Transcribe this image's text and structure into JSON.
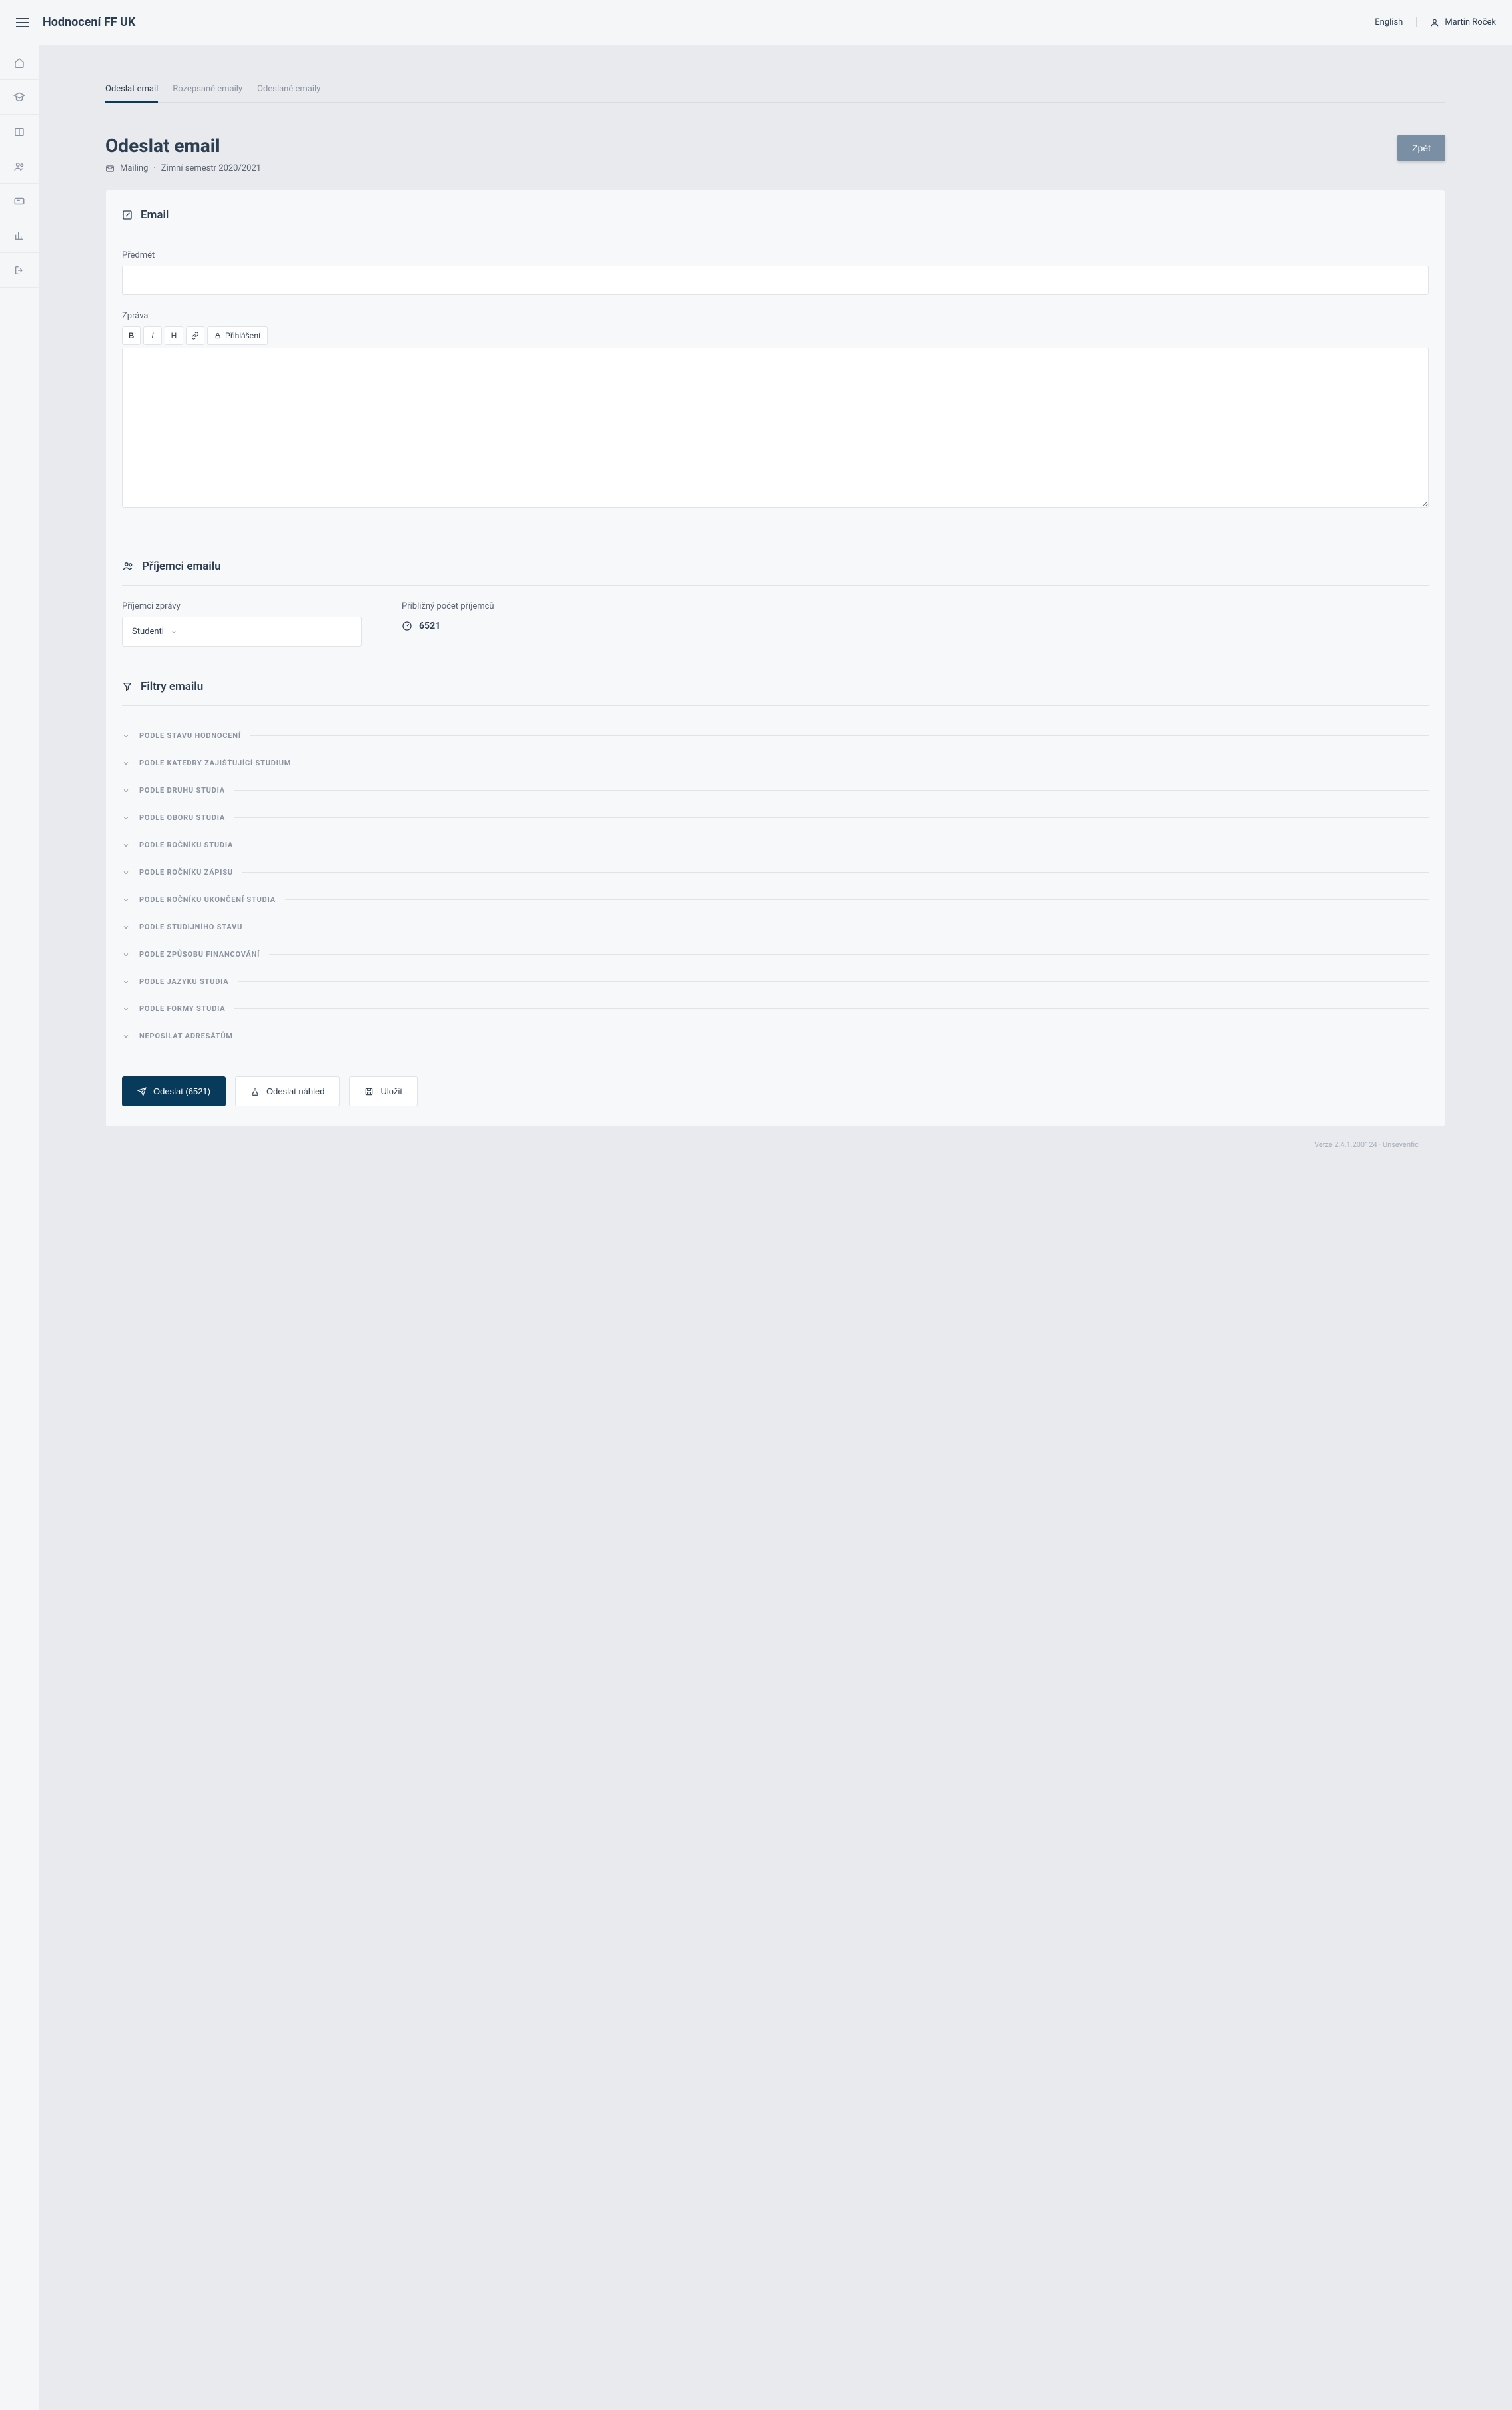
{
  "header": {
    "title": "Hodnocení FF UK",
    "language": "English",
    "user": "Martin Roček"
  },
  "tabs": [
    {
      "label": "Odeslat email",
      "active": true
    },
    {
      "label": "Rozepsané emaily",
      "active": false
    },
    {
      "label": "Odeslané emaily",
      "active": false
    }
  ],
  "page": {
    "title": "Odeslat email",
    "breadcrumb_section": "Mailing",
    "breadcrumb_semester": "Zimní semestr 2020/2021",
    "back_button": "Zpět"
  },
  "email_section": {
    "title": "Email",
    "subject_label": "Předmět",
    "subject_value": "",
    "message_label": "Zpráva",
    "toolbar": {
      "bold": "B",
      "italic": "I",
      "heading": "H",
      "login_button": "Přihlášení"
    },
    "message_value": ""
  },
  "recipients_section": {
    "title": "Příjemci emailu",
    "recipients_label": "Příjemci zprávy",
    "selected_recipient": "Studenti",
    "count_label": "Přibližný počet příjemců",
    "count_value": "6521"
  },
  "filters_section": {
    "title": "Filtry emailu",
    "filters": [
      "Podle stavu hodnocení",
      "Podle katedry zajišťující studium",
      "Podle druhu studia",
      "Podle oboru studia",
      "Podle ročníku studia",
      "Podle ročníku zápisu",
      "Podle ročníku ukončení studia",
      "Podle studijního stavu",
      "Podle způsobu financování",
      "Podle jazyku studia",
      "Podle formy studia",
      "Neposílat adresátům"
    ]
  },
  "actions": {
    "send": "Odeslat (6521)",
    "preview": "Odeslat náhled",
    "save": "Uložit"
  },
  "footer": {
    "version": "Verze 2.4.1.200124 · Unseverific"
  }
}
